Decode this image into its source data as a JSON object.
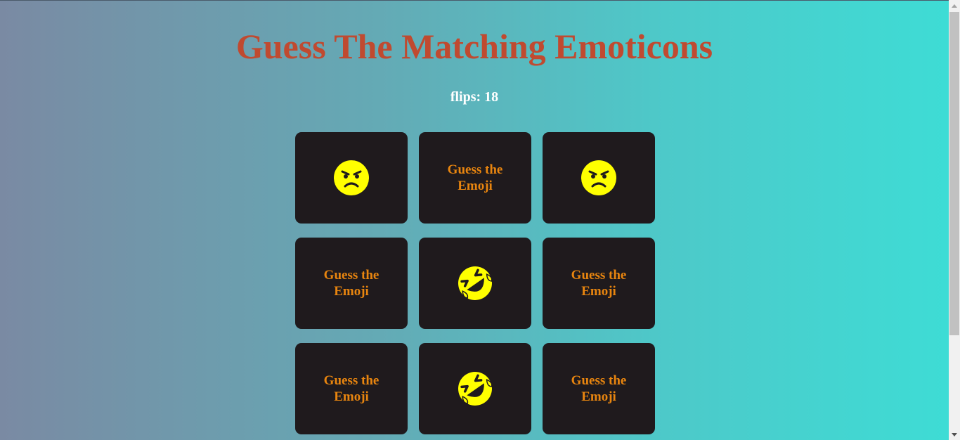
{
  "game": {
    "title": "Guess The Matching Emoticons",
    "flips_label": "flips: 18"
  },
  "cards": [
    {
      "state": "revealed",
      "emoji": "angry-face-icon"
    },
    {
      "state": "hidden",
      "label": "Guess the Emoji"
    },
    {
      "state": "revealed",
      "emoji": "angry-face-icon"
    },
    {
      "state": "hidden",
      "label": "Guess the Emoji"
    },
    {
      "state": "revealed",
      "emoji": "rolling-laughing-face-icon"
    },
    {
      "state": "hidden",
      "label": "Guess the Emoji"
    },
    {
      "state": "hidden",
      "label": "Guess the Emoji"
    },
    {
      "state": "revealed",
      "emoji": "rolling-laughing-face-icon"
    },
    {
      "state": "hidden",
      "label": "Guess the Emoji"
    }
  ],
  "colors": {
    "title": "#c04a30",
    "card_background": "#1f1a1d",
    "card_text": "#e8850f",
    "emoji_fill": "#ffff00"
  }
}
